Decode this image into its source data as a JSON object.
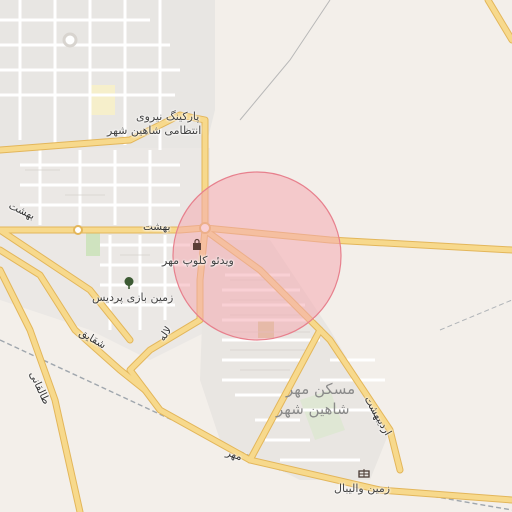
{
  "map": {
    "highlight_color": "#f4a9b0",
    "road_color": "#f5d27e",
    "labels": {
      "parking": "پارکینگ نیروی",
      "parking2": "انتظامی شاهین شهر",
      "behesht_top": "بهشت",
      "behesht_left": "بهشت",
      "video": "ویدئو کلوپ مهر",
      "park": "زمین بازی پردیس",
      "lale": "لاله",
      "shaghayegh": "شقایق",
      "taleghani": "طالقانی",
      "maskan1": "مسکن مهر",
      "maskan2": "شاهین شهر",
      "ordibehesht": "اردیبهشت",
      "mehr": "مهر",
      "volleyball": "زمین والیبال"
    },
    "icons": [
      "shopping-bag-icon",
      "tree-icon",
      "volleyball-court-icon"
    ]
  }
}
